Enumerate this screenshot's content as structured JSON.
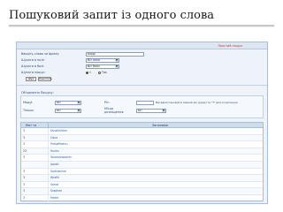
{
  "slide": {
    "title": "Пошуковий запит із одного слова"
  },
  "panel": {
    "header_text": "Простий пошук",
    "form": {
      "row1_label": "Введіть слово чи фразу:",
      "row1_value": "варді",
      "row2_label": "Шукати в полі:",
      "row2_value": "Всі поля",
      "row3_label": "Шукати в базі:",
      "row3_value": "Всі бази",
      "row4_label": "Шукати пошук:",
      "radio_on_label": "з",
      "radio_off_label": "Так",
      "btn1_label": "Шук",
      "btn2_label": "Очистить"
    },
    "section": {
      "title": "Об'єднання Пошуку:",
      "r1_label": "Модуі:",
      "r1_select": "всі",
      "r2_label": "Тільки:",
      "r2_select": "всі",
      "field3_label": "Ріс:",
      "field4_label": "Місця розміщення:",
      "field4_select": "всі",
      "note": "Вмсадпостановой в повний рік (рррр) та \"Т\" для скорочення"
    },
    "table": {
      "col1_header": "Мат та",
      "col2_header": "Заголовок",
      "rows": [
        {
          "c1": "3",
          "c2": "Fanalthhtim"
        },
        {
          "c1": "3",
          "c2": "Osna"
        },
        {
          "c1": "3",
          "c2": "Pressffidenu"
        },
        {
          "c1": "23",
          "c2": "Hucks"
        },
        {
          "c1": "3",
          "c2": "Yoisekshaberer"
        },
        {
          "c1": "",
          "c2": "Ipwah"
        },
        {
          "c1": "3",
          "c2": "Sarthalckie"
        },
        {
          "c1": "3",
          "c2": "Wraftt"
        },
        {
          "c1": "3",
          "c2": "Sanet"
        },
        {
          "c1": "3",
          "c2": "Sraphen"
        },
        {
          "c1": "3",
          "c2": "Heele"
        }
      ]
    }
  }
}
